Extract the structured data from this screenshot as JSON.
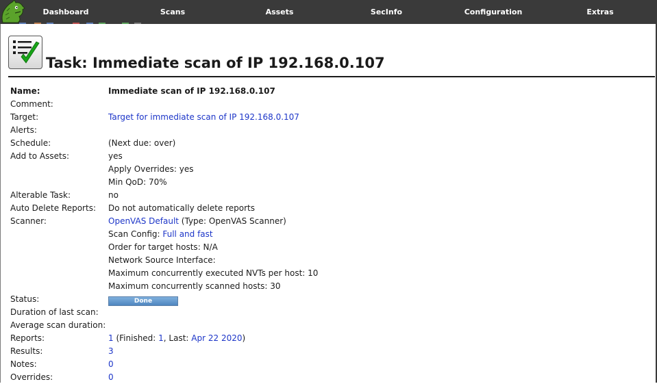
{
  "nav": {
    "items": [
      "Dashboard",
      "Scans",
      "Assets",
      "SecInfo",
      "Configuration",
      "Extras"
    ]
  },
  "page": {
    "title": "Task: Immediate scan of IP 192.168.0.107"
  },
  "details": {
    "name_label": "Name:",
    "name_value": "Immediate scan of IP 192.168.0.107",
    "comment_label": "Comment:",
    "target_label": "Target:",
    "target_value": "Target for immediate scan of IP 192.168.0.107",
    "alerts_label": "Alerts:",
    "schedule_label": "Schedule:",
    "schedule_value": "(Next due: over)",
    "assets_label": "Add to Assets:",
    "assets_value": "yes",
    "apply_overrides": "Apply Overrides: yes",
    "min_qod": "Min QoD: 70%",
    "alterable_label": "Alterable Task:",
    "alterable_value": "no",
    "auto_delete_label": "Auto Delete Reports:",
    "auto_delete_value": "Do not automatically delete reports",
    "scanner_label": "Scanner:",
    "scanner_name": "OpenVAS Default",
    "scanner_type": " (Type: OpenVAS Scanner)",
    "scan_config_prefix": "Scan Config: ",
    "scan_config_value": "Full and fast",
    "order_hosts": "Order for target hosts: N/A",
    "network_source": "Network Source Interface:",
    "max_nvts": "Maximum concurrently executed NVTs per host: 10",
    "max_hosts": "Maximum concurrently scanned hosts: 30",
    "status_label": "Status:",
    "status_value": "Done",
    "status_progress": 1.0,
    "duration_label": "Duration of last scan:",
    "avg_duration_label": "Average scan duration:",
    "reports_label": "Reports:",
    "reports_count": "1",
    "reports_finished_prefix": " (Finished: ",
    "reports_finished_count": "1",
    "reports_last_prefix": ", Last: ",
    "reports_last_date": "Apr 22 2020",
    "reports_suffix": ")",
    "results_label": "Results:",
    "results_value": "3",
    "notes_label": "Notes:",
    "notes_value": "0",
    "overrides_label": "Overrides:",
    "overrides_value": "0"
  },
  "colors": {
    "topbar": "#3a3a3a",
    "link": "#1c35c8",
    "logo_green": "#5ba32b",
    "check_green": "#17a317"
  }
}
